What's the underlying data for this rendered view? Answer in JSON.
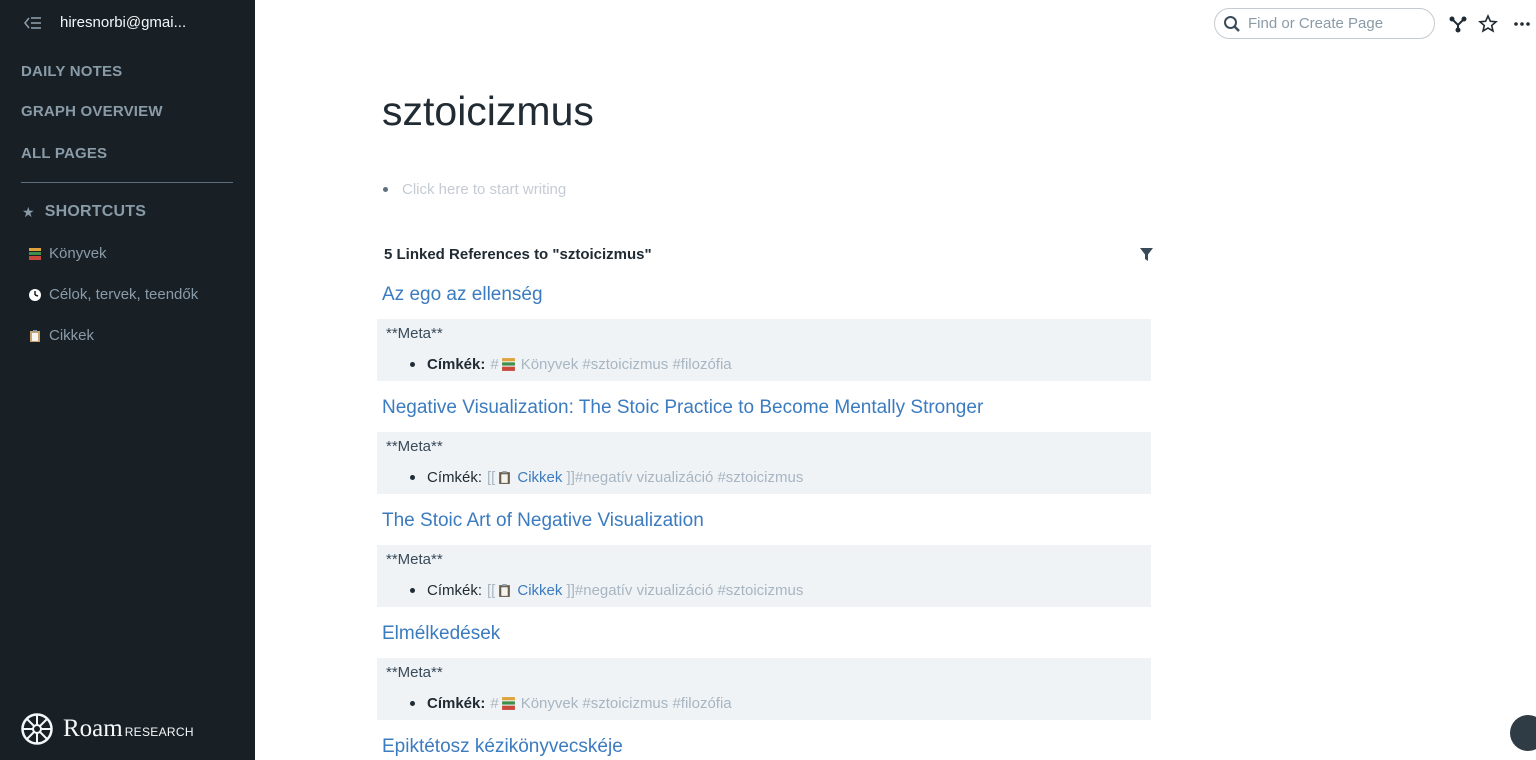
{
  "sidebar": {
    "user": "hiresnorbi@gmai...",
    "nav": [
      "DAILY NOTES",
      "GRAPH OVERVIEW",
      "ALL PAGES"
    ],
    "shortcuts_heading": "SHORTCUTS",
    "shortcuts": [
      {
        "label": "Könyvek",
        "icon": "books-emoji-icon"
      },
      {
        "label": "Célok, tervek, teendők",
        "icon": "clock-emoji-icon"
      },
      {
        "label": "Cikkek",
        "icon": "clipboard-emoji-icon"
      }
    ],
    "logo": {
      "word": "Roam",
      "sub": "RESEARCH"
    }
  },
  "topbar": {
    "search_placeholder": "Find or Create Page"
  },
  "page": {
    "title": "sztoicizmus",
    "empty_prompt": "Click here to start writing",
    "linked_refs_title": "5 Linked References to \"sztoicizmus\""
  },
  "references": [
    {
      "title": "Az ego az ellenség",
      "meta": "**Meta**",
      "label": "Címkék:",
      "prefix": "#",
      "link": "Könyvek",
      "suffix": "#sztoicizmus #filozófia"
    },
    {
      "title": "Negative Visualization: The Stoic Practice to Become Mentally Stronger",
      "meta": "**Meta**",
      "label": "Címkék:",
      "prefix": "[[",
      "link": "Cikkek",
      "suffix": "]]#negatív vizualizáció #sztoicizmus"
    },
    {
      "title": "The Stoic Art of Negative Visualization",
      "meta": "**Meta**",
      "label": "Címkék:",
      "prefix": "[[",
      "link": "Cikkek",
      "suffix": "]]#negatív vizualizáció #sztoicizmus"
    },
    {
      "title": "Elmélkedések",
      "meta": "**Meta**",
      "label": "Címkék:",
      "prefix": "#",
      "link": "Könyvek",
      "suffix": "#sztoicizmus #filozófia"
    },
    {
      "title": "Epiktétosz kézikönyvecskéje"
    }
  ],
  "colors": {
    "sidebar_bg": "#182026",
    "link": "#3b7bbf",
    "block_bg": "#f0f3f6"
  }
}
